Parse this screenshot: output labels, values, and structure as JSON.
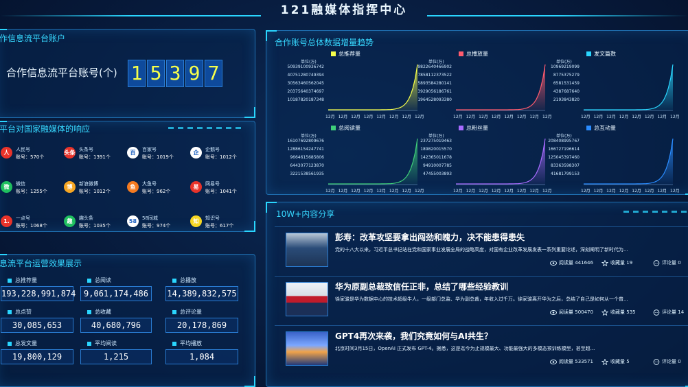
{
  "header": {
    "title": "121融媒体指挥中心"
  },
  "accounts_panel": {
    "title": "作信息流平台账户",
    "label": "合作信息流平台账号(个)",
    "digits": [
      "1",
      "5",
      "3",
      "9",
      "7"
    ]
  },
  "media_panel": {
    "title": "平台对国家融媒体的响应",
    "items": [
      {
        "name": "人民号",
        "count": "账号：570个",
        "icon": "renmin-icon",
        "color": "#e8332a",
        "glyph": "人"
      },
      {
        "name": "头条号",
        "count": "账号：1391个",
        "icon": "toutiao-icon",
        "color": "#e8332a",
        "glyph": "头条"
      },
      {
        "name": "百家号",
        "count": "账号：1019个",
        "icon": "baijia-icon",
        "color": "#ffffff",
        "glyph": "百"
      },
      {
        "name": "企鹅号",
        "count": "账号：1012个",
        "icon": "penguin-icon",
        "color": "#ffffff",
        "glyph": "企"
      },
      {
        "name": "微信",
        "count": "账号：1255个",
        "icon": "wechat-icon",
        "color": "#1fbf5f",
        "glyph": "微"
      },
      {
        "name": "新浪微博",
        "count": "账号：1012个",
        "icon": "weibo-icon",
        "color": "#f6a623",
        "glyph": "博"
      },
      {
        "name": "大鱼号",
        "count": "账号：962个",
        "icon": "dayu-icon",
        "color": "#f47a20",
        "glyph": "鱼"
      },
      {
        "name": "网易号",
        "count": "账号：1041个",
        "icon": "netease-icon",
        "color": "#e8332a",
        "glyph": "易"
      },
      {
        "name": "一点号",
        "count": "账号：1068个",
        "icon": "yidian-icon",
        "color": "#e8332a",
        "glyph": "1."
      },
      {
        "name": "趣头条",
        "count": "账号：1035个",
        "icon": "qutoutiao-icon",
        "color": "#1fbf5f",
        "glyph": "趣"
      },
      {
        "name": "58同城",
        "count": "账号：974个",
        "icon": "58-icon",
        "color": "#ffffff",
        "glyph": "58"
      },
      {
        "name": "知识号",
        "count": "账号：617个",
        "icon": "zhishi-icon",
        "color": "#f6d623",
        "glyph": "知"
      }
    ]
  },
  "stats_panel": {
    "title": "息流平台运营效果展示",
    "items": [
      {
        "label": "总推荐量",
        "value": "193,228,991,874"
      },
      {
        "label": "总阅读",
        "value": "9,061,174,486"
      },
      {
        "label": "总播放",
        "value": "14,389,832,575"
      },
      {
        "label": "总点赞",
        "value": "30,085,653"
      },
      {
        "label": "总收藏",
        "value": "40,680,796"
      },
      {
        "label": "总评论量",
        "value": "20,178,869"
      },
      {
        "label": "总发文量",
        "value": "19,800,129"
      },
      {
        "label": "平均阅读",
        "value": "1,215"
      },
      {
        "label": "平均播放",
        "value": "1,084"
      }
    ]
  },
  "trend_panel": {
    "title": "合作账号总体数据增量趋势",
    "unit": "单位(万)",
    "x_label": "12月",
    "charts": [
      {
        "title": "总推荐量",
        "color": "#f6ff4a",
        "yticks": [
          "50939100936742",
          "40751280749394",
          "30563460562045",
          "20375640374697",
          "10187820187348"
        ]
      },
      {
        "title": "总播放量",
        "color": "#ff5b6e",
        "yticks": [
          "9822640466902",
          "7858112373522",
          "5893584280141",
          "3929056186761",
          "1964528093380"
        ]
      },
      {
        "title": "发文篇数",
        "color": "#2ad6ff",
        "yticks": [
          "10969219099",
          "8775375279",
          "6581531459",
          "4387687640",
          "2193843820"
        ]
      },
      {
        "title": "总阅读量",
        "color": "#3fcf7a",
        "yticks": [
          "16107692809676",
          "12886154247741",
          "9664615685806",
          "6443077123870",
          "3221538561935"
        ]
      },
      {
        "title": "总粉丝量",
        "color": "#a86bff",
        "yticks": [
          "237275019463",
          "189820015570",
          "142365011678",
          "94910007785",
          "47455003893"
        ]
      },
      {
        "title": "总互动量",
        "color": "#2a8cff",
        "yticks": [
          "208408995767",
          "166727196614",
          "125045397460",
          "83363598307",
          "41681799153"
        ]
      }
    ]
  },
  "content_panel": {
    "title": "10W+内容分享",
    "read_prefix": "阅读量",
    "fav_prefix": "收藏量",
    "comment_prefix": "评论量",
    "articles": [
      {
        "title": "彭寿：改革攻坚要拿出闯劲和魄力，决不能患得患失",
        "desc": "党的十八大以来，习近平总书记站在党和国家事业发展全局的战略高度，对国有企业改革发展发表一系列重要论述，深刻阐明了新时代为...",
        "reads": "441646",
        "favs": "19",
        "comments": "0"
      },
      {
        "title": "华为原副总裁致信任正非，总结了哪些经验教训",
        "desc": "徐家骏是华为数据中心的技术超级牛人，一级部门总监、华为副总裁，年收入过千万。徐家骏离开华为之后，总结了自己是如何从一个普...",
        "reads": "500470",
        "favs": "535",
        "comments": "14"
      },
      {
        "title": "GPT4再次来袭，我们究竟如何与AI共生？",
        "desc": "北京时间3月15日，OpenAI 正式发布 GPT-4。据悉，这是迄今为止规模最大、功能最强大的多模态预训练模型，甚至超...",
        "reads": "533571",
        "favs": "5",
        "comments": "0"
      }
    ]
  }
}
